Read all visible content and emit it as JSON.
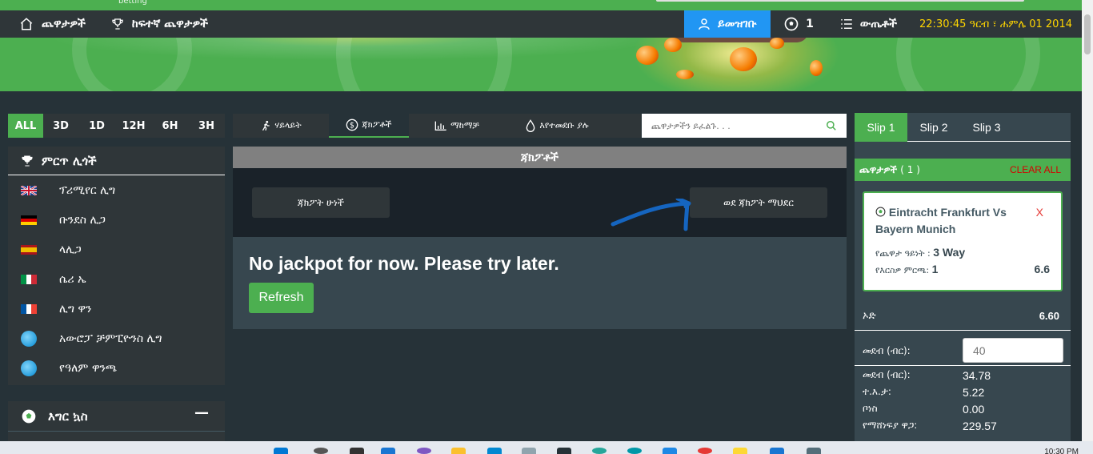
{
  "brand": {
    "sub": "betting"
  },
  "nav": {
    "games": "ጨዋታዎች",
    "top_games": "ከፍተኛ ጨዋታዎች",
    "login": "ይመዝገቡ",
    "ball_count": "1",
    "results": "ውጤቶች",
    "clock": "22:30:45 ዓርብ ፣ ሐምሌ 01 2014"
  },
  "time_filters": [
    {
      "label": "ALL",
      "active": true
    },
    {
      "label": "3D",
      "active": false
    },
    {
      "label": "1D",
      "active": false
    },
    {
      "label": "12H",
      "active": false
    },
    {
      "label": "6H",
      "active": false
    },
    {
      "label": "3H",
      "active": false
    }
  ],
  "leagues": {
    "title": "ምርጥ ሊጎች",
    "items": [
      {
        "label": "ፕሪሚየር ሊግ",
        "flag": "uk-flag"
      },
      {
        "label": "ቡንደስ ሊጋ",
        "flag": "germany-flag"
      },
      {
        "label": "ላሊጋ",
        "flag": "spain-flag"
      },
      {
        "label": "ሴሪ ኤ",
        "flag": "italy-flag"
      },
      {
        "label": "ሊግ ዋን",
        "flag": "france-flag"
      },
      {
        "label": "አውሮፓ ቻምፒዮንስ ሊግ",
        "flag": "globe-icon"
      },
      {
        "label": "የዓለም ዋንጫ",
        "flag": "globe-icon"
      }
    ]
  },
  "sport": {
    "title": "እግር ኳስ",
    "toggle": "—"
  },
  "mid_tabs": [
    {
      "label": "ሃይላይት",
      "icon": "runner-icon",
      "active": false
    },
    {
      "label": "ጃክፖቶች",
      "icon": "dollar-icon",
      "active": true
    },
    {
      "label": "ማከማቻ",
      "icon": "bar-chart-icon",
      "active": false
    },
    {
      "label": "እየተመደቡ ያሉ",
      "icon": "drop-icon",
      "active": false
    }
  ],
  "search": {
    "placeholder": "ጨዋታዎችን ይፈልጉ. . ."
  },
  "jackpot": {
    "title": "ጃክፖቶች",
    "history_btn": "ጃክፖት ሁነች",
    "go_btn": "ወደ ጃክፖት ማህደር",
    "message": "No jackpot for now. Please try later.",
    "refresh": "Refresh"
  },
  "slip": {
    "tabs": [
      {
        "label": "Slip 1",
        "active": true
      },
      {
        "label": "Slip 2",
        "active": false
      },
      {
        "label": "Slip 3",
        "active": false
      }
    ],
    "games_label": "ጨዋታዎች",
    "games_count": "( 1 )",
    "clear": "CLEAR ALL",
    "bet": {
      "match": "Eintracht Frankfurt Vs Bayern Munich",
      "close": "X",
      "type_label": "የጨዋታ ዓይነት :",
      "type_value": "3 Way",
      "pick_label": "የእርስዎ ምርጫ:",
      "pick_value": "1",
      "odd": "6.6"
    },
    "total_odds_label": "ኦድ",
    "total_odds": "6.60",
    "stake_label": "መደብ (ብር):",
    "stake_value": "40",
    "summary": [
      {
        "label": "መደብ (ብር):",
        "value": "34.78"
      },
      {
        "label": "ተ.እ.ታ:",
        "value": "5.22"
      },
      {
        "label": "ቦነስ",
        "value": "0.00"
      },
      {
        "label": "የማሸነፍያ ዋጋ:",
        "value": "229.57"
      }
    ]
  },
  "taskbar": {
    "time": "10:30 PM"
  },
  "colors": {
    "green": "#4caf50",
    "blue": "#2196f3",
    "dark": "#263238",
    "yellow": "#ffd600",
    "red": "#d50000"
  }
}
